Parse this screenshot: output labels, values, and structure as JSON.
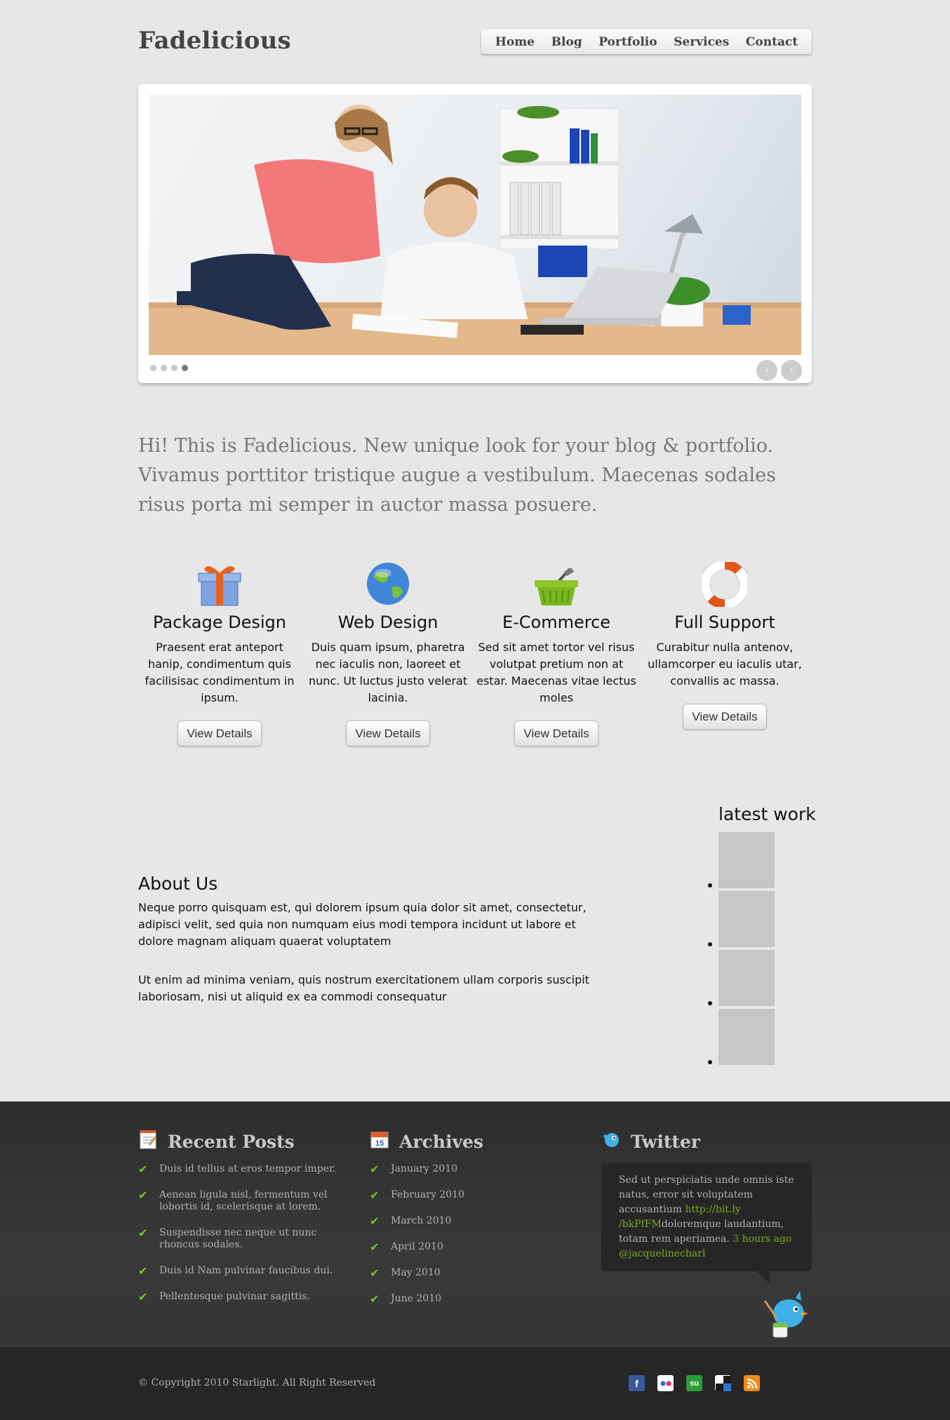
{
  "header": {
    "logo": "Fadelicious",
    "nav": [
      "Home",
      "Blog",
      "Portfolio",
      "Services",
      "Contact"
    ]
  },
  "slider": {
    "total_slides": 4,
    "active_slide": 4,
    "prev_icon": "chevron-left-icon",
    "next_icon": "chevron-right-icon"
  },
  "intro": "Hi! This is Fadelicious. New unique look for your blog & portfolio. Vivamus porttitor tristique augue a vestibulum. Maecenas sodales risus porta mi semper in auctor massa posuere.",
  "services": [
    {
      "icon": "gift-icon",
      "title": "Package Design",
      "text": "Praesent erat anteport hanip, condimentum quis facilisisac condimentum in ipsum.",
      "button": "View Details"
    },
    {
      "icon": "globe-icon",
      "title": "Web Design",
      "text": "Duis quam ipsum, pharetra nec iaculis non, laoreet et nunc. Ut luctus justo velerat lacinia.",
      "button": "View Details"
    },
    {
      "icon": "basket-icon",
      "title": "E-Commerce",
      "text": "Sed sit amet tortor vel risus volutpat pretium non at estar. Maecenas vitae lectus moles",
      "button": "View Details"
    },
    {
      "icon": "lifebuoy-icon",
      "title": "Full Support",
      "text": "Curabitur nulla antenov, ullamcorper eu iaculis utar, convallis ac massa.",
      "button": "View Details"
    }
  ],
  "about": {
    "title": "About Us",
    "p1": "Neque porro quisquam est, qui dolorem ipsum quia dolor sit amet, consectetur, adipisci velit, sed quia non numquam eius modi tempora incidunt ut labore et dolore magnam aliquam quaerat voluptatem",
    "p2": "Ut enim ad minima veniam, quis nostrum exercitationem ullam corporis suscipit laboriosam, nisi ut aliquid ex ea commodi consequatur"
  },
  "latest_work": {
    "title": "latest work",
    "count": 4
  },
  "footer": {
    "recent_posts": {
      "title": "Recent Posts",
      "icon": "notepad-icon",
      "items": [
        "Duis id tellus at eros tempor imper.",
        "Aenean ligula nisl, fermentum vel lobortis id, scelerisque at lorem.",
        "Suspendisse nec neque ut nunc rhoncus sodales.",
        "Duis id Nam pulvinar faucibus dui.",
        "Pellentesque pulvinar sagittis."
      ]
    },
    "archives": {
      "title": "Archives",
      "icon": "calendar-icon",
      "calendar_day": "15",
      "items": [
        "January 2010",
        "February 2010",
        "March 2010",
        "April 2010",
        "May 2010",
        "June 2010"
      ]
    },
    "twitter": {
      "title": "Twitter",
      "icon": "twitter-bird-icon",
      "text1": "Sed ut perspiciatis unde omnis iste natus, error sit voluptatem accusantium ",
      "link": "http://bit.ly /bkPfFM",
      "text2": "doloremque laudantium, totam rem aperiamea. ",
      "time": "3 hours ago",
      "handle": "@jacquelinecharl"
    },
    "copyright": "© Copyright 2010 Starlight. All Right Reserved",
    "socials": [
      {
        "name": "facebook-icon",
        "glyph": "f",
        "color": "#3b5998"
      },
      {
        "name": "flickr-icon",
        "glyph": "••",
        "color": "#1a1a1a"
      },
      {
        "name": "stumbleupon-icon",
        "glyph": "su",
        "color": "#2a9c3a"
      },
      {
        "name": "delicious-icon",
        "glyph": "",
        "color": "#1a1a1a"
      },
      {
        "name": "rss-icon",
        "glyph": "◉",
        "color": "#f08c1b"
      }
    ]
  }
}
